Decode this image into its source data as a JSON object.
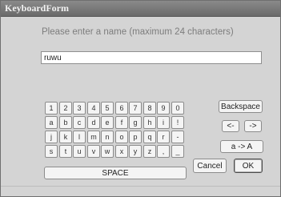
{
  "window": {
    "title": "KeyboardForm"
  },
  "prompt": "Please enter a name (maximum 24 characters)",
  "name_input": {
    "value": "ruwu"
  },
  "keyboard": {
    "rows": [
      [
        "1",
        "2",
        "3",
        "4",
        "5",
        "6",
        "7",
        "8",
        "9",
        "0"
      ],
      [
        "a",
        "b",
        "c",
        "d",
        "e",
        "f",
        "g",
        "h",
        "i",
        "!"
      ],
      [
        "j",
        "k",
        "l",
        "m",
        "n",
        "o",
        "p",
        "q",
        "r",
        "-"
      ],
      [
        "s",
        "t",
        "u",
        "v",
        "w",
        "x",
        "y",
        "z",
        ",",
        "_"
      ]
    ],
    "space_label": "SPACE"
  },
  "buttons": {
    "backspace": "Backspace",
    "left": "<-",
    "right": "->",
    "case_toggle": "a -> A",
    "cancel": "Cancel",
    "ok": "OK"
  }
}
